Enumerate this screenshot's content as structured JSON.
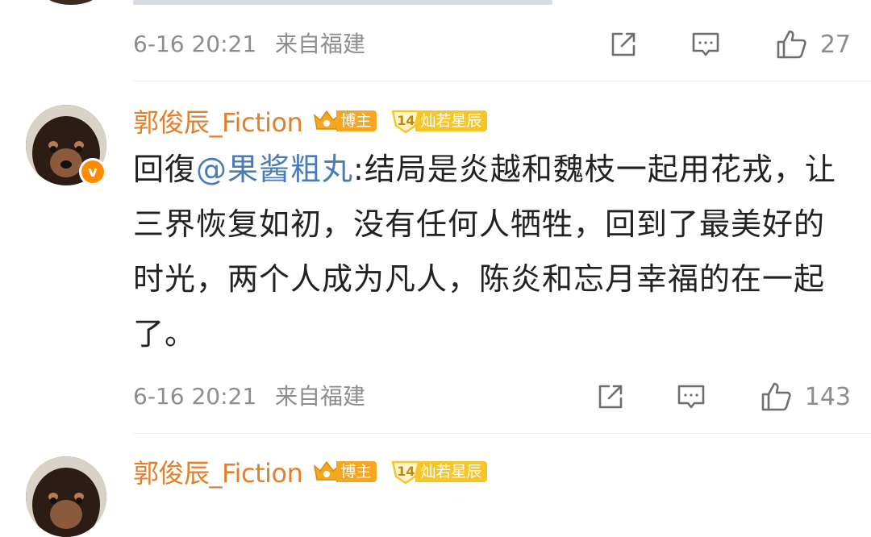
{
  "prev_comment": {
    "time": "6-16 20:21",
    "location": "来自福建",
    "likes": "27",
    "share_icon": "share-icon",
    "comment_icon": "comment-icon",
    "like_icon": "thumbs-up-icon"
  },
  "comment": {
    "username": "郭俊辰_Fiction",
    "verified_badge": "v",
    "host_badge": "博主",
    "level_number": "14",
    "level_title": "灿若星辰",
    "reply_prefix": "回復",
    "mention": "@果酱粗丸",
    "text": ":结局是炎越和魏枝一起用花戎，让三界恢复如初，没有任何人牺牲，回到了最美好的时光，两个人成为凡人，陈炎和忘月幸福的在一起了。",
    "time": "6-16 20:21",
    "location": "来自福建",
    "likes": "143"
  },
  "next_comment": {
    "username": "郭俊辰_Fiction",
    "host_badge": "博主",
    "level_number": "14",
    "level_title": "灿若星辰"
  },
  "colors": {
    "username": "#e37f2b",
    "mention": "#4a7bb7",
    "meta": "#8d8d8d",
    "host_badge": "#f5a623",
    "level_badge": "#f6c628",
    "verified": "#ff8b00"
  }
}
